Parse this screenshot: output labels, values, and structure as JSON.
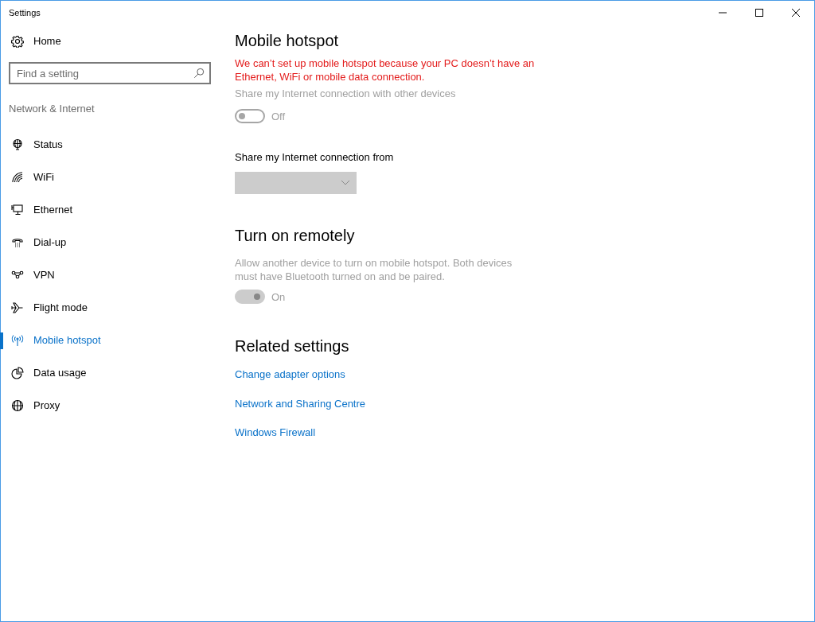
{
  "window": {
    "title": "Settings"
  },
  "sidebar": {
    "home": "Home",
    "search": {
      "placeholder": "Find a setting"
    },
    "section": "Network & Internet",
    "items": [
      {
        "label": "Status",
        "selected": false
      },
      {
        "label": "WiFi",
        "selected": false
      },
      {
        "label": "Ethernet",
        "selected": false
      },
      {
        "label": "Dial-up",
        "selected": false
      },
      {
        "label": "VPN",
        "selected": false
      },
      {
        "label": "Flight mode",
        "selected": false
      },
      {
        "label": "Mobile hotspot",
        "selected": true
      },
      {
        "label": "Data usage",
        "selected": false
      },
      {
        "label": "Proxy",
        "selected": false
      }
    ]
  },
  "content": {
    "title": "Mobile hotspot",
    "error": "We can’t set up mobile hotspot because your PC doesn’t have an Ethernet, WiFi or mobile data connection.",
    "share_toggle": {
      "label": "Share my Internet connection with other devices",
      "on": false,
      "disabled": true,
      "state_text": "Off"
    },
    "share_from": {
      "label": "Share my Internet connection from",
      "disabled": true
    },
    "remote": {
      "title": "Turn on remotely",
      "description": "Allow another device to turn on mobile hotspot. Both devices must have Bluetooth turned on and be paired.",
      "toggle": {
        "on": true,
        "disabled": true,
        "state_text": "On"
      }
    },
    "related": {
      "title": "Related settings",
      "links": [
        "Change adapter options",
        "Network and Sharing Centre",
        "Windows Firewall"
      ]
    }
  }
}
